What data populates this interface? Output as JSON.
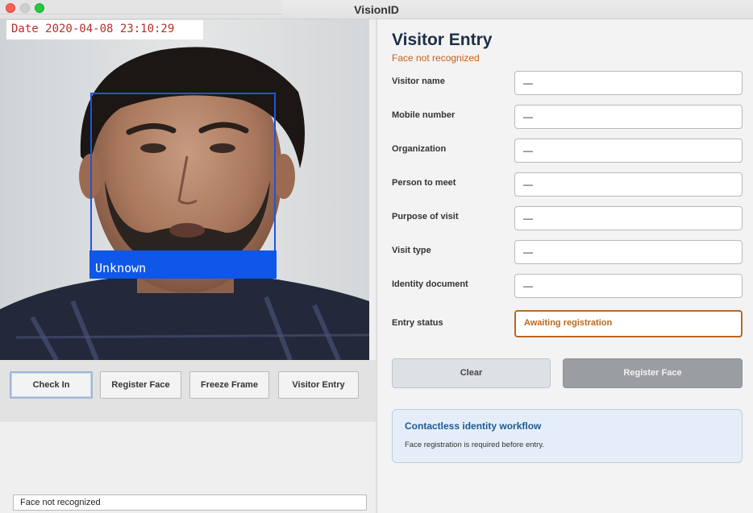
{
  "window": {
    "title": "VisionID"
  },
  "camera": {
    "date_stamp": "Date 2020-04-08 23:10:29",
    "face_label": "Unknown"
  },
  "camera_buttons": {
    "check_in": "Check In",
    "register_face": "Register Face",
    "freeze_frame": "Freeze Frame",
    "visitor_entry": "Visitor Entry"
  },
  "status_bar": {
    "text": "Face not recognized"
  },
  "form": {
    "title": "Visitor Entry",
    "subtitle": "Face not recognized",
    "rows": [
      {
        "label": "Visitor name",
        "value": "—"
      },
      {
        "label": "Mobile number",
        "value": "—"
      },
      {
        "label": "Organization",
        "value": "—"
      },
      {
        "label": "Person to meet",
        "value": "—"
      },
      {
        "label": "Purpose of visit",
        "value": "—"
      },
      {
        "label": "Visit type",
        "value": "—"
      },
      {
        "label": "Identity document",
        "value": "—"
      }
    ],
    "entry_status": {
      "label": "Entry status",
      "value": "Awaiting registration"
    }
  },
  "actions": {
    "clear": "Clear",
    "register_face": "Register Face"
  },
  "info_card": {
    "title": "Contactless identity workflow",
    "text": "Face registration is required before entry."
  },
  "colors": {
    "accent_orange": "#c4611a",
    "face_box_blue": "#0f57e8",
    "title_navy": "#1c2f48",
    "info_blue": "#1b5b94"
  }
}
